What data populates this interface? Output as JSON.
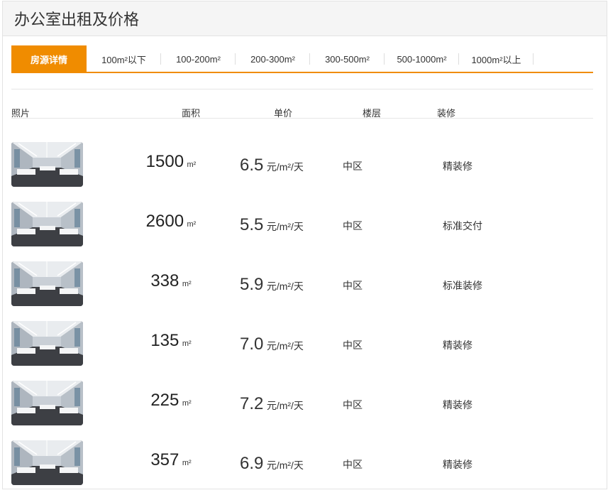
{
  "header": {
    "title": "办公室出租及价格"
  },
  "tabs": [
    {
      "label": "房源详情",
      "active": true
    },
    {
      "label": "100m²以下"
    },
    {
      "label": "100-200m²"
    },
    {
      "label": "200-300m²"
    },
    {
      "label": "300-500m²"
    },
    {
      "label": "500-1000m²"
    },
    {
      "label": "1000m²以上"
    }
  ],
  "columns": {
    "photo": "照片",
    "area": "面积",
    "price": "单价",
    "floor": "楼层",
    "decoration": "装修"
  },
  "units": {
    "area": "m²",
    "price": "元/m²/天"
  },
  "listings": [
    {
      "area": "1500",
      "price": "6.5",
      "floor": "中区",
      "decoration": "精装修"
    },
    {
      "area": "2600",
      "price": "5.5",
      "floor": "中区",
      "decoration": "标准交付"
    },
    {
      "area": "338",
      "price": "5.9",
      "floor": "中区",
      "decoration": "标准装修"
    },
    {
      "area": "135",
      "price": "7.0",
      "floor": "中区",
      "decoration": "精装修"
    },
    {
      "area": "225",
      "price": "7.2",
      "floor": "中区",
      "decoration": "精装修"
    },
    {
      "area": "357",
      "price": "6.9",
      "floor": "中区",
      "decoration": "精装修"
    }
  ],
  "colors": {
    "accent": "#f08c00",
    "header_bg": "#f5f5f5"
  }
}
